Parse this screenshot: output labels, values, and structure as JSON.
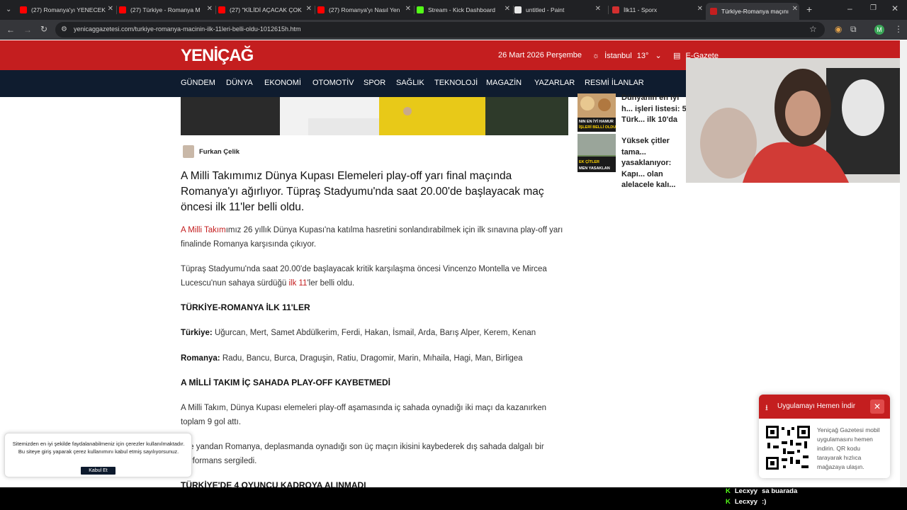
{
  "browser": {
    "tabs": [
      {
        "label": "(27) Romanya'yı YENECEK",
        "icon": "youtube-icon",
        "color": "#ff0000"
      },
      {
        "label": "(27) Türkiye - Romanya M",
        "icon": "youtube-icon",
        "color": "#ff0000"
      },
      {
        "label": "(27) \"KİLİDİ AÇACAK ÇOK",
        "icon": "youtube-icon",
        "color": "#ff0000"
      },
      {
        "label": "(27) Romanya'yı Nasıl Yen",
        "icon": "youtube-icon",
        "color": "#ff0000"
      },
      {
        "label": "Stream - Kick Dashboard",
        "icon": "kick-icon",
        "color": "#53fc18"
      },
      {
        "label": "untitled - Paint",
        "icon": "paint-icon",
        "color": "#e8e8e8"
      },
      {
        "label": "İlk11 - Sporx",
        "icon": "sporx-icon",
        "color": "#d32f2f"
      },
      {
        "label": "Türkiye-Romanya maçını",
        "icon": "yenicag-icon",
        "color": "#c41e1f"
      }
    ],
    "url": "yenicaggazetesi.com/turkiye-romanya-macinin-ilk-11leri-belli-oldu-1012615h.htm",
    "profile_initial": "M"
  },
  "site": {
    "logo": "YENİÇAĞ",
    "date": "26 Mart 2026 Perşembe",
    "city": "İstanbul",
    "temperature": "13°",
    "egazete": "E-Gazete",
    "menu": [
      "GÜNDEM",
      "DÜNYA",
      "EKONOMİ",
      "OTOMOTİV",
      "SPOR",
      "SAĞLIK",
      "TEKNOLOJİ",
      "MAGAZİN",
      "YAZARLAR",
      "RESMİ İLANLAR"
    ]
  },
  "article": {
    "author": "Furkan Çelik",
    "lead": "A Milli Takımımız Dünya Kupası Elemeleri play-off yarı final maçında Romanya'yı ağırlıyor. Tüpraş Stadyumu'nda saat 20.00'de başlayacak maç öncesi ilk 11'ler belli oldu.",
    "p1_link": "A Milli Takım",
    "p1_rest": "ımız 26 yıllık Dünya Kupası'na katılma hasretini sonlandırabilmek için ilk sınavına play-off yarı finalinde Romanya karşısında çıkıyor.",
    "p2_start": "Tüpraş Stadyumu'nda saat 20.00'de başlayacak kritik karşılaşma öncesi Vincenzo Montella ve Mircea Lucescu'nun sahaya sürdüğü ",
    "p2_link": "ilk 11",
    "p2_end": "'ler belli oldu.",
    "h1": "TÜRKİYE-ROMANYA İLK 11'LER",
    "turkiye_label": "Türkiye:",
    "turkiye_lineup": "Uğurcan, Mert, Samet Abdülkerim, Ferdi, Hakan, İsmail, Arda, Barış Alper, Kerem, Kenan",
    "romanya_label": "Romanya:",
    "romanya_lineup": "Radu, Bancu, Burca, Draguşin, Ratiu, Dragomir, Marin, Mıhaila, Hagi, Man, Birligea",
    "h2": "A MİLLİ TAKIM İÇ SAHADA PLAY-OFF KAYBETMEDİ",
    "p3": "A Milli Takım, Dünya Kupası elemeleri play-off aşamasında iç sahada oynadığı iki maçı da kazanırken toplam 9 gol attı.",
    "p4": "Öte yandan Romanya, deplasmanda oynadığı son üç maçın ikisini kaybederek dış sahada dalgalı bir performans sergiledi.",
    "h3": "TÜRKİYE'DE 4 OYUNCU KADROYA ALINMADI"
  },
  "sidebar": {
    "items": [
      {
        "title": "Dünyanın en iyi h... işleri listesi: 5 Türk... ilk 10'da",
        "thumb_text": "NIN EN İYİ HAMUR İŞLERİ BELLİ OLDU"
      },
      {
        "title": "Yüksek çitler tama... yasaklanıyor: Kapı... olan alelacele kalı...",
        "thumb_text": "EK ÇİTLER MEN YASAKLAN"
      }
    ]
  },
  "cookie": {
    "text": "Sitemizden en iyi şekilde faydalanabilmeniz için çerezler kullanılmaktadır. Bu siteye giriş yaparak çerez kullanımını kabul etmiş sayılıyorsunuz.",
    "button": "Kabul Et"
  },
  "promo": {
    "title": "Uygulamayı Hemen İndir",
    "text": "Yeniçağ Gazetesi mobil uygulamasını hemen indirin. QR kodu tarayarak hızlıca mağazaya ulaşın."
  },
  "chat": [
    {
      "user": "Lecxyy",
      "message": "sa buarada"
    },
    {
      "user": "Lecxyy",
      "message": ":)"
    }
  ],
  "colors": {
    "brand_red": "#c41e1f",
    "nav_dark": "#0f1c2f",
    "kick_green": "#53fc18"
  }
}
